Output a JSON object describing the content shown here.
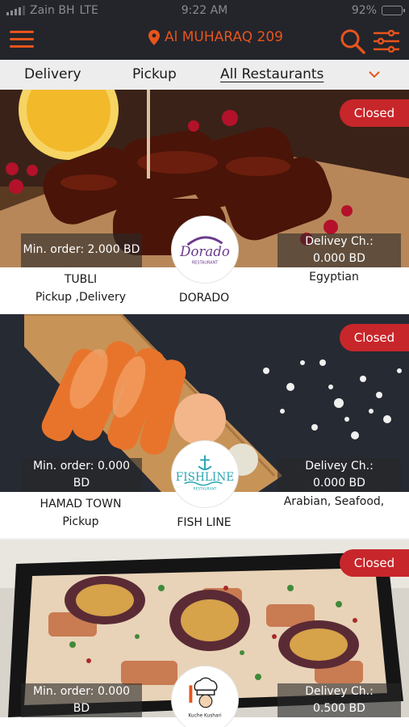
{
  "status_bar": {
    "carrier": "Zain BH",
    "network": "LTE",
    "time": "9:22 AM",
    "battery": "92%",
    "battery_level": 0.92
  },
  "header": {
    "location": "Al MUHARAQ 209"
  },
  "tabs": [
    {
      "label": "Delivery",
      "active": false
    },
    {
      "label": "Pickup",
      "active": false
    },
    {
      "label": "All Restaurants",
      "active": true
    }
  ],
  "restaurants": [
    {
      "status": "Closed",
      "min_order_line1": "Min. order: 2.000 BD",
      "min_order_line2": "",
      "delivery_line1": "Delivey Ch.:",
      "delivery_line2": "0.000 BD",
      "area": "TUBLI",
      "service": "Pickup ,Delivery",
      "name": "DORADO",
      "cuisine": "Egyptian",
      "logo_text": "Dorado",
      "logo_sub": "RESTAURANT"
    },
    {
      "status": "Closed",
      "min_order_line1": "Min. order: 0.000",
      "min_order_line2": "BD",
      "delivery_line1": "Delivey Ch.:",
      "delivery_line2": "0.000 BD",
      "area": "HAMAD TOWN",
      "service": "Pickup",
      "name": "FISH LINE",
      "cuisine": "Arabian, Seafood,",
      "logo_text": "FISHLINE",
      "logo_sub": "RESTAURANT"
    },
    {
      "status": "Closed",
      "min_order_line1": "Min. order: 0.000",
      "min_order_line2": "BD",
      "delivery_line1": "Delivey Ch.:",
      "delivery_line2": "0.500 BD",
      "logo_text": "Kuche Kushari"
    }
  ],
  "colors": {
    "accent": "#e8541c",
    "header_bg": "#23252b",
    "closed_badge": "#c7262a"
  }
}
